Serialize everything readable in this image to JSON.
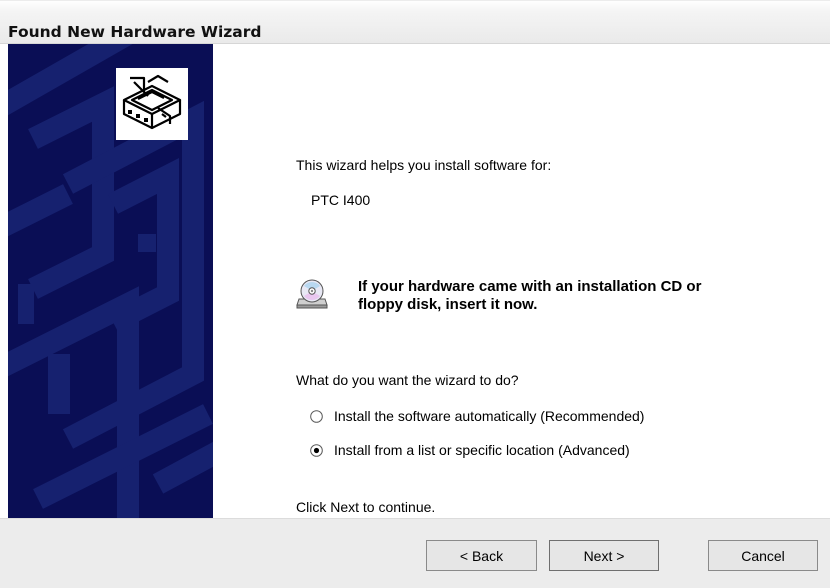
{
  "window": {
    "title": "Found New Hardware Wizard"
  },
  "icons": {
    "wizard": "hardware-box-icon",
    "cd": "cd-disk-icon"
  },
  "content": {
    "intro": "This wizard helps you install software for:",
    "device_name": "PTC I400",
    "cd_message_line1": "If your hardware came with an installation CD or",
    "cd_message_line2": "floppy disk, insert it now.",
    "question": "What do you want the wizard to do?",
    "options": [
      {
        "label": "Install the software automatically (Recommended)",
        "selected": false
      },
      {
        "label": "Install from a list or specific location (Advanced)",
        "selected": true
      }
    ],
    "continue_hint": "Click Next to continue."
  },
  "buttons": {
    "back": "< Back",
    "next": "Next >",
    "cancel": "Cancel"
  },
  "colors": {
    "sidebar": "#0a0e55",
    "sidebar_accent": "#16216f",
    "button_face": "#e6e6e6",
    "footer": "#ececec"
  }
}
